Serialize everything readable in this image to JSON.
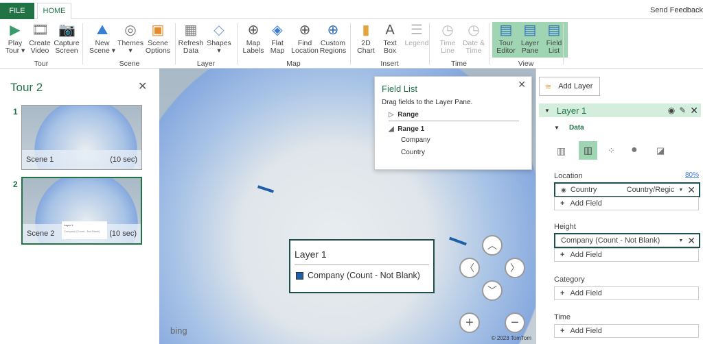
{
  "tabs": {
    "file": "FILE",
    "home": "HOME"
  },
  "feedback": "Send Feedback",
  "ribbon": {
    "buttons": [
      {
        "id": "play-tour",
        "l1": "Play",
        "l2": "Tour ▾"
      },
      {
        "id": "create-video",
        "l1": "Create",
        "l2": "Video"
      },
      {
        "id": "capture-screen",
        "l1": "Capture",
        "l2": "Screen"
      },
      {
        "id": "new-scene",
        "l1": "New",
        "l2": "Scene ▾"
      },
      {
        "id": "themes",
        "l1": "Themes",
        "l2": "▾"
      },
      {
        "id": "scene-options",
        "l1": "Scene",
        "l2": "Options"
      },
      {
        "id": "refresh-data",
        "l1": "Refresh",
        "l2": "Data"
      },
      {
        "id": "shapes",
        "l1": "Shapes",
        "l2": "▾"
      },
      {
        "id": "map-labels",
        "l1": "Map",
        "l2": "Labels"
      },
      {
        "id": "flat-map",
        "l1": "Flat",
        "l2": "Map"
      },
      {
        "id": "find-location",
        "l1": "Find",
        "l2": "Location"
      },
      {
        "id": "custom-regions",
        "l1": "Custom",
        "l2": "Regions"
      },
      {
        "id": "2d-chart",
        "l1": "2D",
        "l2": "Chart"
      },
      {
        "id": "text-box",
        "l1": "Text",
        "l2": "Box"
      },
      {
        "id": "legend",
        "l1": "Legend",
        "l2": ""
      },
      {
        "id": "time-line",
        "l1": "Time",
        "l2": "Line"
      },
      {
        "id": "date-time",
        "l1": "Date &",
        "l2": "Time"
      },
      {
        "id": "tour-editor",
        "l1": "Tour",
        "l2": "Editor"
      },
      {
        "id": "layer-pane",
        "l1": "Layer",
        "l2": "Pane"
      },
      {
        "id": "field-list",
        "l1": "Field",
        "l2": "List"
      }
    ],
    "groups": [
      "Tour",
      "Scene",
      "Layer",
      "Map",
      "Insert",
      "Time",
      "View"
    ]
  },
  "tour": {
    "title": "Tour 2",
    "scenes": [
      {
        "num": "1",
        "name": "Scene 1",
        "duration": "(10 sec)"
      },
      {
        "num": "2",
        "name": "Scene 2",
        "duration": "(10 sec)"
      }
    ],
    "thumb_legend_title": "Layer 1",
    "thumb_legend_item": "Company (Count - Not Blank)"
  },
  "field_list": {
    "title": "Field List",
    "hint": "Drag fields to the Layer Pane.",
    "tables": [
      "Range",
      "Range 1"
    ],
    "fields": [
      "Company",
      "Country"
    ]
  },
  "legend": {
    "title": "Layer 1",
    "item": "Company (Count - Not Blank)",
    "color": "#1f5fa8"
  },
  "map": {
    "brand": "bing",
    "copyright": "© 2023 TomTom"
  },
  "layer_pane": {
    "add_layer": "Add Layer",
    "layer_name": "Layer 1",
    "data_section": "Data",
    "location_label": "Location",
    "location_pct": "80%",
    "location_field": "Country",
    "location_type": "Country/Regic",
    "add_field": "Add Field",
    "height_label": "Height",
    "height_field": "Company (Count - Not Blank)",
    "category_label": "Category",
    "time_label": "Time"
  }
}
